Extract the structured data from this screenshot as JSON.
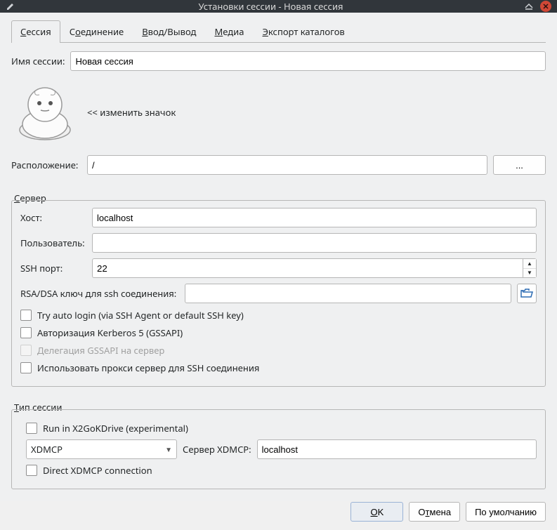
{
  "window": {
    "title": "Установки сессии - Новая сессия"
  },
  "tabs": {
    "session": "Сессия",
    "session_m": "С",
    "connection": "Соединение",
    "connection_m": "о",
    "io": "Ввод/Вывод",
    "io_m": "В",
    "io_rest": "вод/Вывод",
    "media": "Медиа",
    "media_m": "М",
    "export": "Экспорт каталогов",
    "export_m": "Э"
  },
  "session": {
    "name_label": "Имя сессии:",
    "name_value": "Новая сессия",
    "change_icon": "<< изменить значок",
    "location_label": "Расположение:",
    "location_value": "/",
    "ellipsis": "..."
  },
  "server": {
    "group_label_pre": "С",
    "group_label_rest": "ервер",
    "host_label": "Хост:",
    "host_value": "localhost",
    "user_label": "Пользователь:",
    "user_value": "",
    "ssh_port_label": "SSH порт:",
    "ssh_port_value": "22",
    "rsa_label": "RSA/DSA ключ для ssh соединения:",
    "rsa_value": "",
    "try_auto": "Try auto login (via SSH Agent or default SSH key)",
    "kerberos": "Авторизация Kerberos 5 (GSSAPI)",
    "delegation": "Делегация GSSAPI на сервер",
    "proxy": "Использовать прокси сервер для SSH соединения"
  },
  "session_type": {
    "group_label_pre": "Т",
    "group_label_rest": "ип сессии",
    "run_kdrive": "Run in X2GoKDrive (experimental)",
    "combo_value": "XDMCP",
    "xdmcp_label": "Сервер XDMCP:",
    "xdmcp_value": "localhost",
    "direct": "Direct XDMCP connection"
  },
  "footer": {
    "ok_m": "O",
    "ok_rest": "K",
    "cancel_pre": "О",
    "cancel_m": "т",
    "cancel_rest": "мена",
    "defaults": "По умолчанию"
  }
}
